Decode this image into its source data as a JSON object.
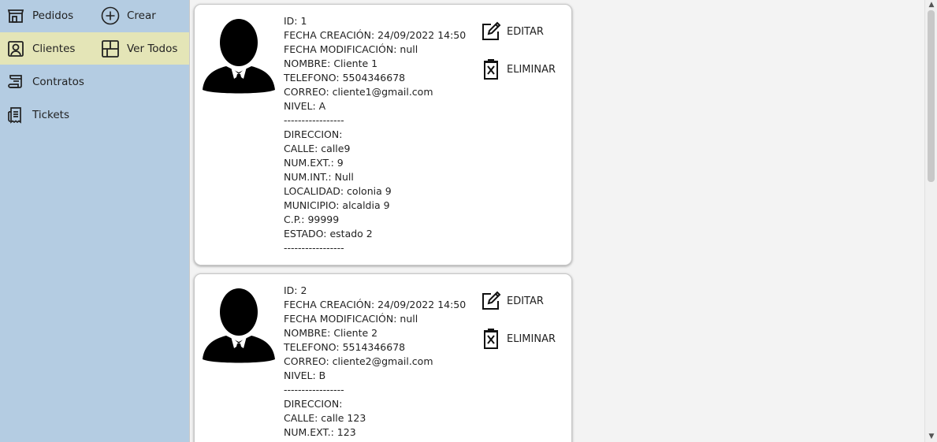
{
  "sidebar": {
    "items": [
      {
        "label": "Pedidos",
        "icon": "store-icon"
      },
      {
        "label": "Crear",
        "icon": "plus-circle-icon"
      },
      {
        "label": "Clientes",
        "icon": "user-card-icon"
      },
      {
        "label": "Ver Todos",
        "icon": "layout-grid-icon"
      },
      {
        "label": "Contratos",
        "icon": "contract-icon"
      },
      {
        "label": "Tickets",
        "icon": "receipt-icon"
      }
    ],
    "selected_color": "#e4e5b7",
    "background_color": "#b4cce2"
  },
  "actions": {
    "edit_label": "EDITAR",
    "delete_label": "ELIMINAR"
  },
  "clients": [
    {
      "lines": [
        "ID: 1",
        "FECHA CREACIÓN: 24/09/2022 14:50",
        "FECHA MODIFICACIÓN: null",
        "NOMBRE: Cliente 1",
        "TELEFONO: 5504346678",
        "CORREO: cliente1@gmail.com",
        "NIVEL: A",
        "-----------------",
        "DIRECCION:",
        "CALLE: calle9",
        "NUM.EXT.: 9",
        "NUM.INT.: Null",
        "LOCALIDAD: colonia 9",
        "MUNICIPIO: alcaldia 9",
        "C.P.: 99999",
        "ESTADO: estado 2",
        "-----------------"
      ]
    },
    {
      "lines": [
        "ID: 2",
        "FECHA CREACIÓN: 24/09/2022 14:50",
        "FECHA MODIFICACIÓN: null",
        "NOMBRE: Cliente 2",
        "TELEFONO: 5514346678",
        "CORREO: cliente2@gmail.com",
        "NIVEL: B",
        "-----------------",
        "DIRECCION:",
        "CALLE: calle 123",
        "NUM.EXT.: 123"
      ]
    }
  ]
}
